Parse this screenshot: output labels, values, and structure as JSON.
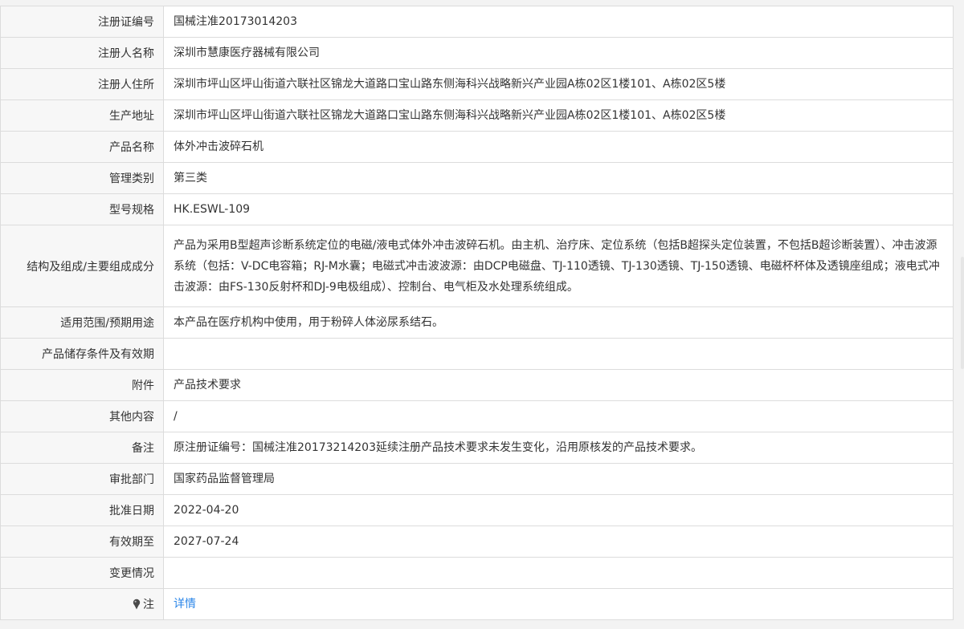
{
  "rows": [
    {
      "label": "注册证编号",
      "value": "国械注准20173014203"
    },
    {
      "label": "注册人名称",
      "value": "深圳市慧康医疗器械有限公司"
    },
    {
      "label": "注册人住所",
      "value": "深圳市坪山区坪山街道六联社区锦龙大道路口宝山路东侧海科兴战略新兴产业园A栋02区1楼101、A栋02区5楼"
    },
    {
      "label": "生产地址",
      "value": "深圳市坪山区坪山街道六联社区锦龙大道路口宝山路东侧海科兴战略新兴产业园A栋02区1楼101、A栋02区5楼"
    },
    {
      "label": "产品名称",
      "value": "体外冲击波碎石机"
    },
    {
      "label": "管理类别",
      "value": "第三类"
    },
    {
      "label": "型号规格",
      "value": "HK.ESWL-109"
    },
    {
      "label": "结构及组成/主要组成成分",
      "value": "产品为采用B型超声诊断系统定位的电磁/液电式体外冲击波碎石机。由主机、治疗床、定位系统（包括B超探头定位装置，不包括B超诊断装置）、冲击波源系统（包括：V-DC电容箱；RJ-M水囊；电磁式冲击波波源：由DCP电磁盘、TJ-110透镜、TJ-130透镜、TJ-150透镜、电磁杯杯体及透镜座组成；液电式冲击波源：由FS-130反射杯和DJ-9电极组成）、控制台、电气柜及水处理系统组成。"
    },
    {
      "label": "适用范围/预期用途",
      "value": "本产品在医疗机构中使用，用于粉碎人体泌尿系结石。"
    },
    {
      "label": "产品储存条件及有效期",
      "value": ""
    },
    {
      "label": "附件",
      "value": "产品技术要求"
    },
    {
      "label": "其他内容",
      "value": "/"
    },
    {
      "label": "备注",
      "value": "原注册证编号：国械注准20173214203延续注册产品技术要求未发生变化，沿用原核发的产品技术要求。"
    },
    {
      "label": "审批部门",
      "value": "国家药品监督管理局"
    },
    {
      "label": "批准日期",
      "value": "2022-04-20"
    },
    {
      "label": "有效期至",
      "value": "2027-07-24"
    },
    {
      "label": "变更情况",
      "value": ""
    }
  ],
  "note": {
    "icon": "pin-icon",
    "label": "注",
    "link_text": "详情",
    "link_color": "#2b86e8"
  }
}
